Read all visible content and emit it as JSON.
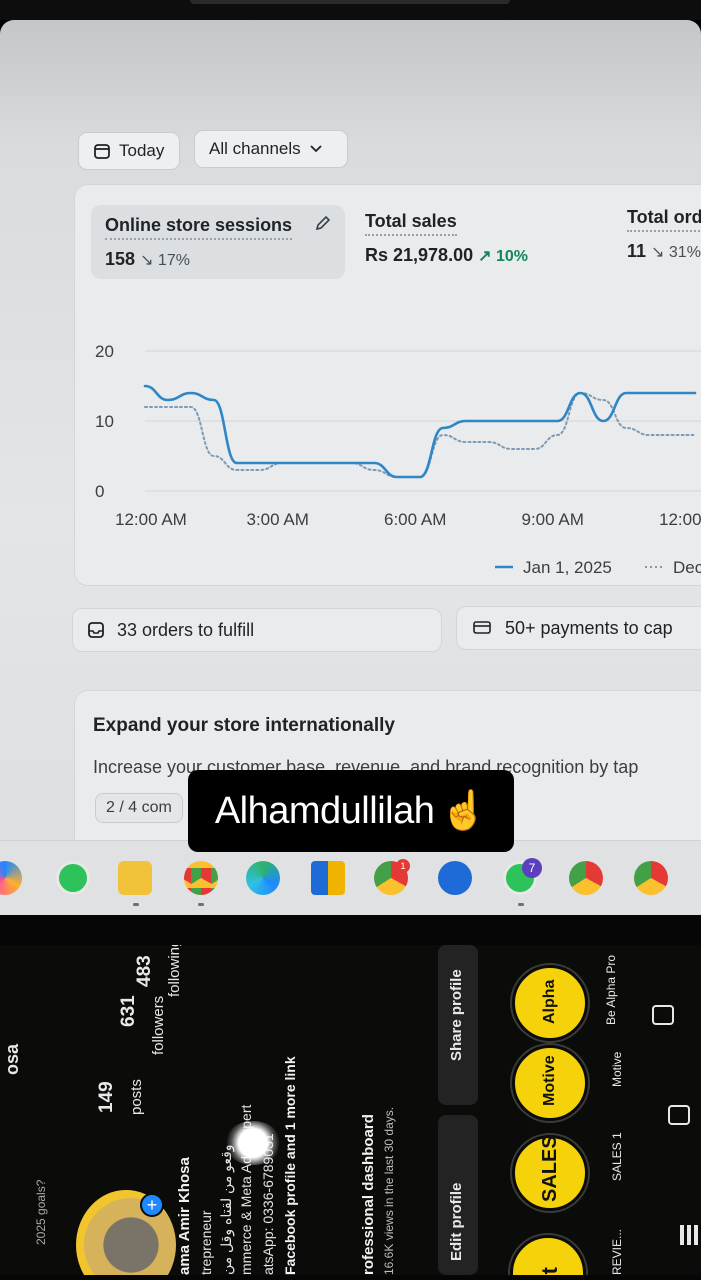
{
  "dashboard": {
    "date_filter": "Today",
    "channel_filter": "All channels",
    "metrics": [
      {
        "label": "Online store sessions",
        "value": "158",
        "trend": "↘ 17%"
      },
      {
        "label": "Total sales",
        "value": "Rs 21,978.00",
        "trend": "↗ 10%"
      },
      {
        "label": "Total ord",
        "value": "11",
        "trend": "↘ 31%"
      }
    ],
    "legend": {
      "current": "Jan 1, 2025",
      "previous": "Dec"
    },
    "tasks": {
      "orders": "33 orders to fulfill",
      "payments": "50+ payments to cap"
    },
    "expand": {
      "title": "Expand your store internationally",
      "desc": "Increase your customer base, revenue, and brand recognition by tap",
      "progress": "2 / 4 com"
    }
  },
  "chart_data": {
    "type": "line",
    "yticks": [
      "20",
      "10",
      "0"
    ],
    "xticks": [
      "12:00 AM",
      "3:00 AM",
      "6:00 AM",
      "9:00 AM",
      "12:00"
    ],
    "ylim": [
      0,
      20
    ],
    "x": [
      0.0,
      0.5,
      1.0,
      1.5,
      2.0,
      2.5,
      3.0,
      3.5,
      4.0,
      4.5,
      5.0,
      5.5,
      6.0,
      6.5,
      7.0,
      7.5,
      8.0,
      8.5,
      9.0,
      9.5,
      10.0,
      10.5,
      11.0,
      11.5,
      12.0
    ],
    "series": [
      {
        "name": "Jan 1, 2025",
        "values": [
          15,
          13,
          14,
          13,
          4,
          4,
          4,
          4,
          4,
          4,
          4,
          2,
          2,
          9,
          10,
          10,
          10,
          10,
          10,
          14,
          10,
          14,
          14,
          14,
          14
        ]
      },
      {
        "name": "Dec",
        "values": [
          12,
          12,
          12,
          5,
          3,
          3,
          4,
          4,
          4,
          4,
          3,
          2,
          2,
          8,
          7,
          7,
          6,
          6,
          8,
          14,
          13,
          9,
          8,
          8,
          8
        ]
      }
    ],
    "grid": true
  },
  "overlay": {
    "text": "Alhamdullilah",
    "emoji": "☝"
  },
  "taskbar": {
    "badge_chrome": "1",
    "badge_whatsapp": "7"
  },
  "profile": {
    "posts": "149",
    "posts_label": "posts",
    "followers": "631",
    "followers_label": "followers",
    "following": "483",
    "following_label": "following",
    "name_line": "ama Amir Khosa",
    "bio_lines": [
      "trepreneur",
      "وقعو من لقتاه وقل من",
      "mmerce & Meta Ads Expert",
      "atsApp: 0336-6789031",
      "Facebook profile and 1 more link"
    ],
    "dashboard_title": "rofessional dashboard",
    "dashboard_sub": "16.6K views in the last 30 days.",
    "edit_button": "Edit profile",
    "share_button": "Share profile",
    "highlights": [
      {
        "title": "ent",
        "label": "REVIE..."
      },
      {
        "title": "SALES",
        "label": "SALES 1"
      },
      {
        "title": "Motive",
        "label": "Motive"
      },
      {
        "title": "Alpha",
        "label": "Be Alpha Pro"
      }
    ],
    "corner_note": "2025 goals?",
    "username": "osa"
  },
  "colors": {
    "accent_line": "#2f86c6",
    "trend_up": "#13865a",
    "highlight_yellow": "#f6d20a"
  }
}
